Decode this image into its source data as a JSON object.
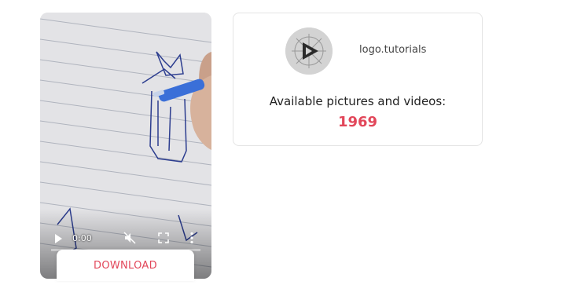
{
  "video": {
    "time": "0:00",
    "progress": 0
  },
  "download_label": "DOWNLOAD",
  "profile": {
    "username": "logo.tutorials",
    "avatar_icon": "play-logo-icon"
  },
  "stats": {
    "available_label": "Available pictures and videos:",
    "count": "1969"
  },
  "colors": {
    "accent": "#e2475a",
    "card_border": "#e4e4e4"
  }
}
